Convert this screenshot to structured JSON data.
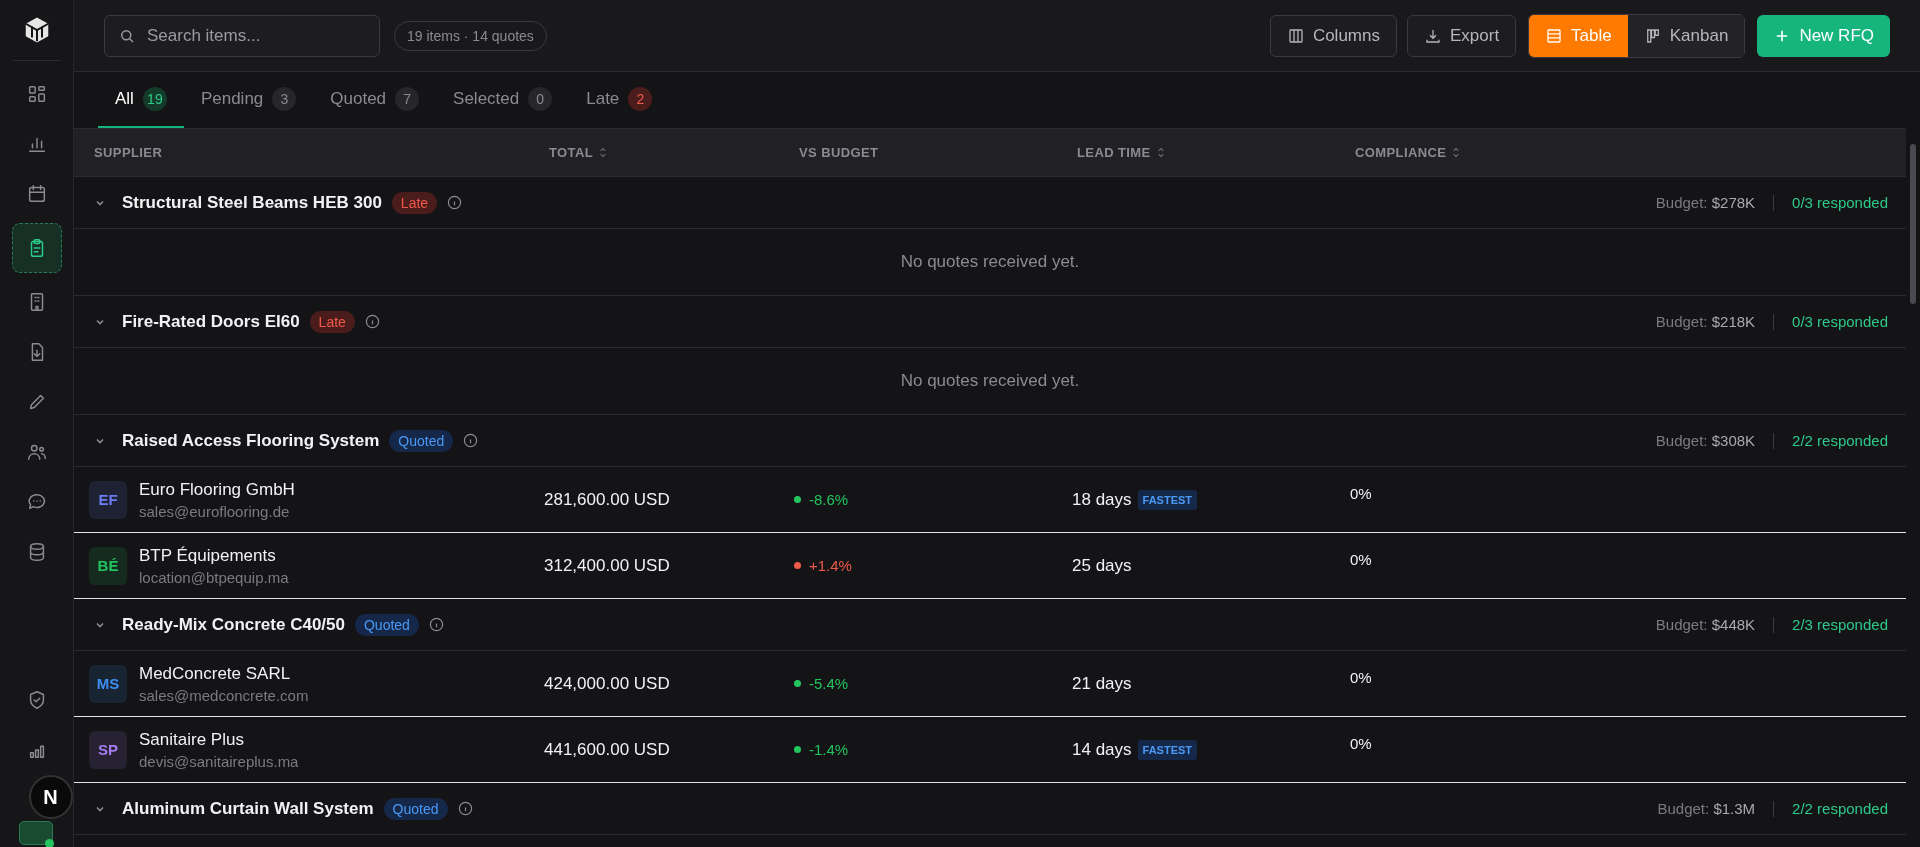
{
  "sidebar": {
    "items": [
      {
        "selected": false
      },
      {
        "selected": false
      },
      {
        "selected": false
      },
      {
        "selected": true
      },
      {
        "selected": false
      },
      {
        "selected": false
      },
      {
        "selected": false
      },
      {
        "selected": false
      },
      {
        "selected": false
      },
      {
        "selected": false
      }
    ],
    "bottom_items": [
      {
        "selected": false
      },
      {
        "selected": false
      }
    ],
    "dev_badge": "N"
  },
  "toolbar": {
    "search": {
      "placeholder": "Search items..."
    },
    "summary": "19 items · 14 quotes",
    "buttons": [
      {
        "kind": "columns",
        "label": "Columns"
      },
      {
        "kind": "export",
        "label": "Export"
      }
    ],
    "views": [
      {
        "kind": "table",
        "label": "Table",
        "selected": true
      },
      {
        "kind": "kanban",
        "label": "Kanban",
        "selected": false
      }
    ],
    "primary": "New RFQ"
  },
  "tabs": [
    {
      "label": "All",
      "count": "19",
      "selected": true,
      "kind": "normal"
    },
    {
      "label": "Pending",
      "count": "3",
      "selected": false,
      "kind": "normal"
    },
    {
      "label": "Quoted",
      "count": "7",
      "selected": false,
      "kind": "normal"
    },
    {
      "label": "Selected",
      "count": "0",
      "selected": false,
      "kind": "normal"
    },
    {
      "label": "Late",
      "count": "2",
      "selected": false,
      "kind": "alert"
    }
  ],
  "table": {
    "columns": [
      {
        "label": "SUPPLIER",
        "sortable": false
      },
      {
        "label": "TOTAL",
        "sortable": true
      },
      {
        "label": "VS BUDGET",
        "sortable": false
      },
      {
        "label": "LEAD TIME",
        "sortable": true
      },
      {
        "label": "COMPLIANCE",
        "sortable": true
      }
    ],
    "groups": [
      {
        "title": "Structural Steel Beams HEB 300",
        "kind": "late",
        "status_label": "Late",
        "expanded": true,
        "budget_label": "Budget:",
        "budget": "$278K",
        "responded": "0/3 responded",
        "empty_message": "No quotes received yet."
      },
      {
        "title": "Fire-Rated Doors EI60",
        "kind": "late",
        "status_label": "Late",
        "expanded": true,
        "budget_label": "Budget:",
        "budget": "$218K",
        "responded": "0/3 responded",
        "empty_message": "No quotes received yet."
      },
      {
        "title": "Raised Access Flooring System",
        "kind": "quoted",
        "status_label": "Quoted",
        "expanded": true,
        "budget_label": "Budget:",
        "budget": "$308K",
        "responded": "2/2 responded",
        "quotes": [
          {
            "initials": "EF",
            "color": "#6b7cf5",
            "name": "Euro Flooring GmbH",
            "email": "sales@euroflooring.de",
            "total": "281,600.00 USD",
            "kind": "under",
            "vs_budget": "-8.6%",
            "lead_time": "18 days",
            "fastest": true,
            "fastest_label": "FASTEST",
            "compliance": "0%"
          },
          {
            "initials": "BÉ",
            "color": "#22c55e",
            "name": "BTP Équipements",
            "email": "location@btpequip.ma",
            "total": "312,400.00 USD",
            "kind": "over",
            "vs_budget": "+1.4%",
            "lead_time": "25 days",
            "fastest": false,
            "compliance": "0%"
          }
        ]
      },
      {
        "title": "Ready-Mix Concrete C40/50",
        "kind": "quoted",
        "status_label": "Quoted",
        "expanded": true,
        "budget_label": "Budget:",
        "budget": "$448K",
        "responded": "2/3 responded",
        "quotes": [
          {
            "initials": "MS",
            "color": "#3b8ef0",
            "name": "MedConcrete SARL",
            "email": "sales@medconcrete.com",
            "total": "424,000.00 USD",
            "kind": "under",
            "vs_budget": "-5.4%",
            "lead_time": "21 days",
            "fastest": false,
            "compliance": "0%"
          },
          {
            "initials": "SP",
            "color": "#a47cf0",
            "name": "Sanitaire Plus",
            "email": "devis@sanitaireplus.ma",
            "total": "441,600.00 USD",
            "kind": "under",
            "vs_budget": "-1.4%",
            "lead_time": "14 days",
            "fastest": true,
            "fastest_label": "FASTEST",
            "compliance": "0%"
          }
        ]
      },
      {
        "title": "Aluminum Curtain Wall System",
        "kind": "quoted",
        "status_label": "Quoted",
        "expanded": true,
        "budget_label": "Budget:",
        "budget": "$1.3M",
        "responded": "2/2 responded"
      }
    ]
  }
}
